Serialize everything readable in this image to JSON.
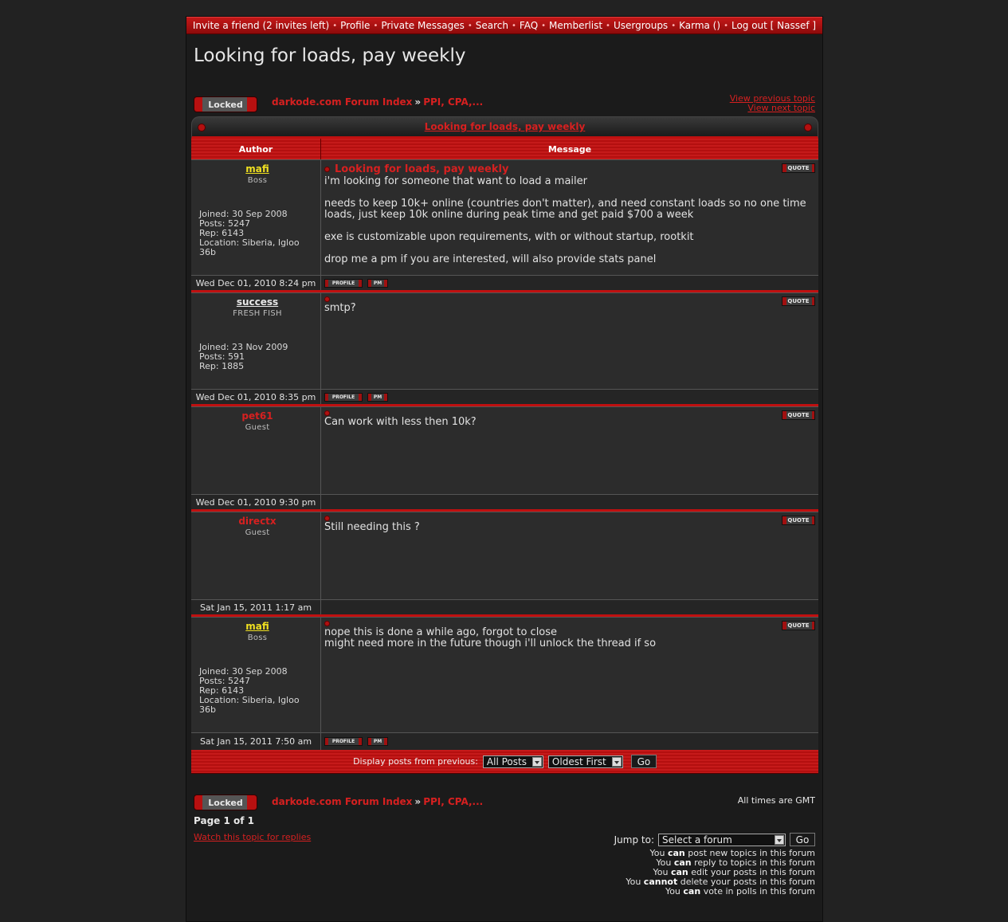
{
  "nav": {
    "items": [
      "Invite a friend (2 invites left)",
      "Profile",
      "Private Messages",
      "Search",
      "FAQ",
      "Memberlist",
      "Usergroups",
      "Karma ()",
      "Log out [ Nassef ]"
    ],
    "separator": "•"
  },
  "page_title": "Looking for loads, pay weekly",
  "locked_label": "Locked",
  "breadcrumb": {
    "index": "darkode.com Forum Index",
    "arrow": "»",
    "forum": "PPI, CPA,..."
  },
  "topic_links": {
    "prev": "View previous topic",
    "next": "View next topic"
  },
  "table": {
    "topic_title": "Looking for loads, pay weekly",
    "col_author": "Author",
    "col_message": "Message",
    "quote_label": "QUOTE",
    "profile_label": "PROFILE",
    "pm_label": "PM"
  },
  "posts": [
    {
      "username": "mafi",
      "rank": "Boss",
      "info": [
        "Joined: 30 Sep 2008",
        "Posts: 5247",
        "Rep: 6143",
        "Location: Siberia, Igloo",
        "36b"
      ],
      "subject": "Looking for loads, pay weekly",
      "message": [
        "i'm looking for someone that want to load a mailer",
        "needs to keep 10k+ online (countries don't matter), and need constant loads so no one time loads, just keep 10k online during peak time and get paid $700 a week",
        "exe is customizable upon requirements, with or without startup, rootkit",
        "drop me a pm if you are interested, will also provide stats panel"
      ],
      "date": "Wed Dec 01, 2010 8:24 pm"
    },
    {
      "username": "success",
      "rank": "FRESH FISH",
      "info": [
        "Joined: 23 Nov 2009",
        "Posts: 591",
        "Rep: 1885"
      ],
      "subject": "",
      "message": [
        "smtp?"
      ],
      "date": "Wed Dec 01, 2010 8:35 pm"
    },
    {
      "username": "pet61",
      "rank": "Guest",
      "info": [],
      "subject": "",
      "message": [
        "Can work with less then 10k?"
      ],
      "date": "Wed Dec 01, 2010 9:30 pm"
    },
    {
      "username": "directx",
      "rank": "Guest",
      "info": [],
      "subject": "",
      "message": [
        "Still needing this ?"
      ],
      "date": "Sat Jan 15, 2011 1:17 am"
    },
    {
      "username": "mafi",
      "rank": "Boss",
      "info": [
        "Joined: 30 Sep 2008",
        "Posts: 5247",
        "Rep: 6143",
        "Location: Siberia, Igloo",
        "36b"
      ],
      "subject": "",
      "message": [
        "nope this is done a while ago, forgot to close",
        "might need more in the future though i'll unlock the thread if so"
      ],
      "date": "Sat Jan 15, 2011 7:50 am"
    }
  ],
  "display": {
    "label": "Display posts from previous:",
    "range": "All Posts",
    "order": "Oldest First",
    "go": "Go"
  },
  "footer": {
    "timezone": "All times are GMT",
    "page": "Page 1 of 1",
    "watch": "Watch this topic for replies",
    "jump_label": "Jump to:",
    "jump_value": "Select a forum",
    "jump_go": "Go",
    "perms": [
      {
        "pre": "You",
        "verb": "can",
        "post": "post new topics in this forum"
      },
      {
        "pre": "You",
        "verb": "can",
        "post": "reply to topics in this forum"
      },
      {
        "pre": "You",
        "verb": "can",
        "post": "edit your posts in this forum"
      },
      {
        "pre": "You",
        "verb": "cannot",
        "post": "delete your posts in this forum"
      },
      {
        "pre": "You",
        "verb": "can",
        "post": "vote in polls in this forum"
      }
    ]
  },
  "colors": {
    "accent": "#d62020",
    "admin": "#f0e020",
    "bg": "#1b1b1b"
  }
}
